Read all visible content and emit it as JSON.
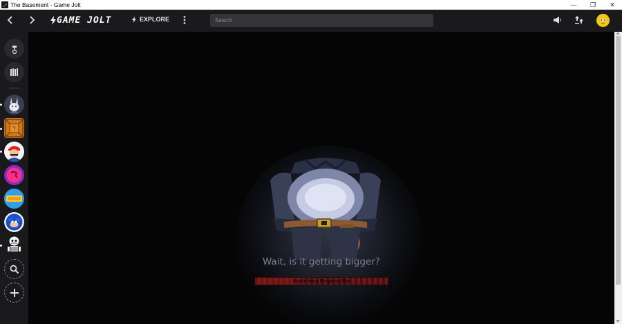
{
  "window": {
    "title": "The Basement - Game Jolt",
    "controls": {
      "minimize": "—",
      "maximize": "❐",
      "close": "✕"
    }
  },
  "topnav": {
    "logo": "GAME JOLT",
    "explore_label": "EXPLORE",
    "search_placeholder": "Search",
    "icons": [
      "back-arrow-icon",
      "forward-arrow-icon",
      "explore-bolt-icon",
      "more-vertical-icon",
      "announcement-icon",
      "activity-icon"
    ]
  },
  "sidebar": {
    "items": [
      {
        "name": "user-menu-icon"
      },
      {
        "name": "library-icon"
      },
      {
        "name": "community-bunny"
      },
      {
        "name": "community-crate"
      },
      {
        "name": "community-mario"
      },
      {
        "name": "community-fnf"
      },
      {
        "name": "community-memes"
      },
      {
        "name": "community-sonic"
      },
      {
        "name": "community-sans"
      },
      {
        "name": "search-communities"
      },
      {
        "name": "add-community"
      }
    ]
  },
  "main": {
    "caption": "Wait, is it getting bigger?",
    "progress": {
      "label": "Mysterious Progress Bar",
      "value_percent": 35
    }
  },
  "colors": {
    "nav_bg": "#1a1a1c",
    "accent_green": "#2f7f36",
    "progress_red": "#6a1a1b"
  }
}
